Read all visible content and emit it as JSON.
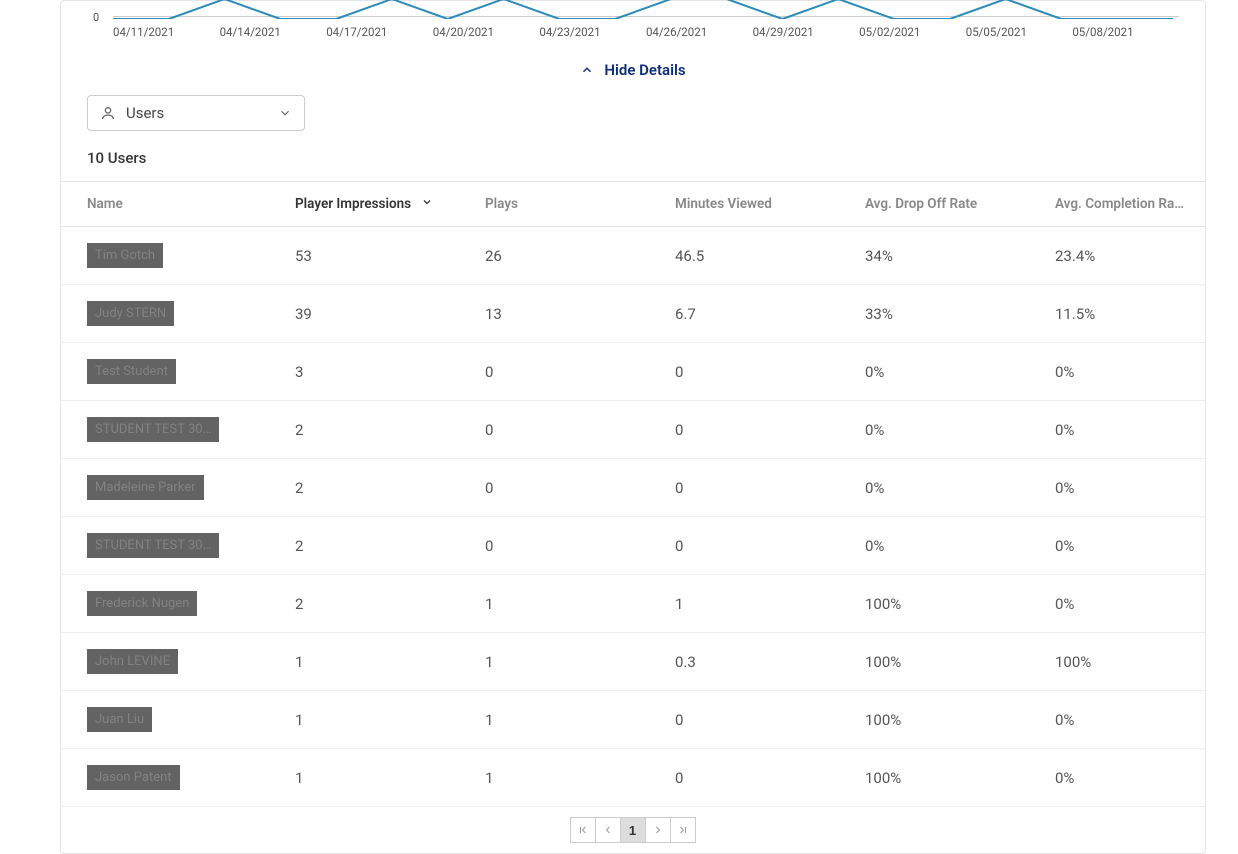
{
  "chart_data": {
    "type": "line",
    "x_labels": [
      "04/11/2021",
      "04/14/2021",
      "04/17/2021",
      "04/20/2021",
      "04/23/2021",
      "04/26/2021",
      "04/29/2021",
      "05/02/2021",
      "05/05/2021",
      "05/08/2021"
    ],
    "series": [
      {
        "name": "metric",
        "color": "#2d8bba",
        "values": [
          0,
          0,
          1,
          0,
          0,
          1,
          0,
          1,
          0,
          0,
          1,
          1,
          0,
          1,
          0,
          0,
          1,
          0,
          0,
          0
        ]
      }
    ],
    "ylim": [
      0,
      1
    ],
    "xlabel": "",
    "ylabel": ""
  },
  "toggle": {
    "label": "Hide Details"
  },
  "filter": {
    "value": "Users"
  },
  "table": {
    "count_label": "10 Users",
    "columns": [
      "Name",
      "Player Impressions",
      "Plays",
      "Minutes Viewed",
      "Avg. Drop Off Rate",
      "Avg. Completion Ra…"
    ],
    "sort_column": "Player Impressions",
    "sort_dir": "desc",
    "rows": [
      {
        "name": "Tim Gotch",
        "impressions": "53",
        "plays": "26",
        "minutes": "46.5",
        "drop": "34%",
        "completion": "23.4%"
      },
      {
        "name": "Judy STERN",
        "impressions": "39",
        "plays": "13",
        "minutes": "6.7",
        "drop": "33%",
        "completion": "11.5%"
      },
      {
        "name": "Test Student",
        "impressions": "3",
        "plays": "0",
        "minutes": "0",
        "drop": "0%",
        "completion": "0%"
      },
      {
        "name": "STUDENT TEST 30…",
        "impressions": "2",
        "plays": "0",
        "minutes": "0",
        "drop": "0%",
        "completion": "0%"
      },
      {
        "name": "Madeleine Parker",
        "impressions": "2",
        "plays": "0",
        "minutes": "0",
        "drop": "0%",
        "completion": "0%"
      },
      {
        "name": "STUDENT TEST 30…",
        "impressions": "2",
        "plays": "0",
        "minutes": "0",
        "drop": "0%",
        "completion": "0%"
      },
      {
        "name": "Frederick Nugen",
        "impressions": "2",
        "plays": "1",
        "minutes": "1",
        "drop": "100%",
        "completion": "0%"
      },
      {
        "name": "John LEVINE",
        "impressions": "1",
        "plays": "1",
        "minutes": "0.3",
        "drop": "100%",
        "completion": "100%"
      },
      {
        "name": "Juan Liu",
        "impressions": "1",
        "plays": "1",
        "minutes": "0",
        "drop": "100%",
        "completion": "0%"
      },
      {
        "name": "Jason Patent",
        "impressions": "1",
        "plays": "1",
        "minutes": "0",
        "drop": "100%",
        "completion": "0%"
      }
    ]
  },
  "pagination": {
    "current": "1"
  }
}
